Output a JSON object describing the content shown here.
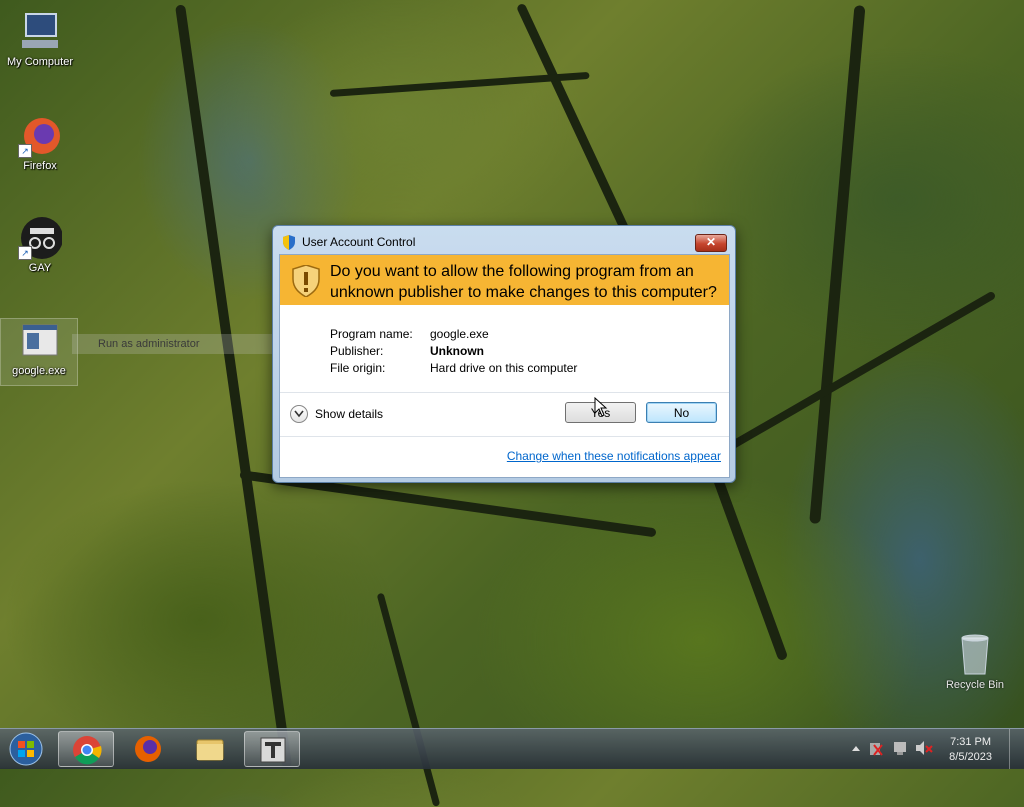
{
  "desktop": {
    "icons": [
      {
        "label": "My Computer"
      },
      {
        "label": "Firefox"
      },
      {
        "label": "GAY"
      },
      {
        "label": "google.exe"
      },
      {
        "label": "Recycle Bin"
      }
    ],
    "context_hint": "Run as administrator"
  },
  "dialog": {
    "title": "User Account Control",
    "close_label": "✕",
    "question": "Do you want to allow the following program from an unknown publisher to make changes to this computer?",
    "program_name_label": "Program name:",
    "program_name_value": "google.exe",
    "publisher_label": "Publisher:",
    "publisher_value": "Unknown",
    "file_origin_label": "File origin:",
    "file_origin_value": "Hard drive on this computer",
    "show_details_label": "Show details",
    "yes_label": "Yes",
    "no_label": "No",
    "notification_link": "Change when these notifications appear",
    "banner_color": "#f6b533"
  },
  "taskbar": {
    "clock_time": "7:31 PM",
    "clock_date": "8/5/2023",
    "pinned": [
      "chrome-icon",
      "firefox-icon",
      "explorer-icon",
      "app-icon"
    ]
  }
}
